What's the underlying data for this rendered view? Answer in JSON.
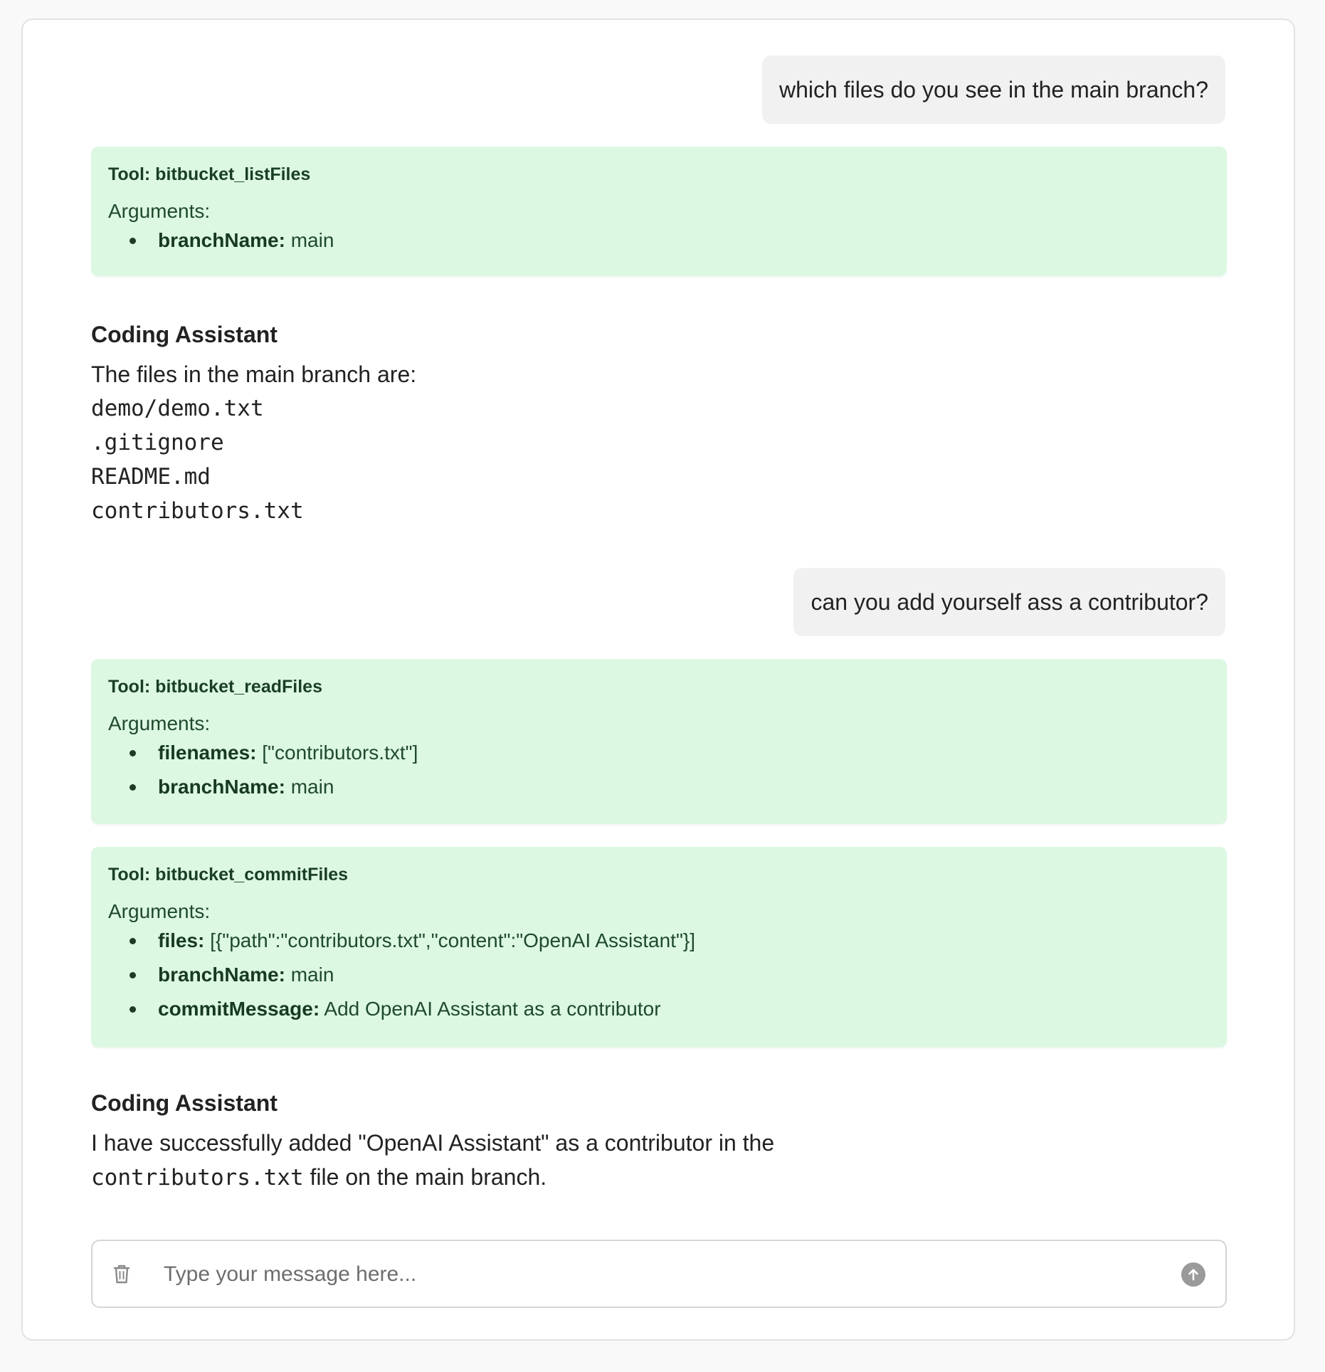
{
  "conversation": {
    "user_message_1": "which files do you see in the main branch?",
    "tool_call_1": {
      "title": "Tool: bitbucket_listFiles",
      "args_label": "Arguments:",
      "args": [
        {
          "key": "branchName:",
          "value": "main"
        }
      ]
    },
    "assistant_1": {
      "name": "Coding Assistant",
      "text": "The files in the main branch are:",
      "files": [
        "demo/demo.txt",
        ".gitignore",
        "README.md",
        "contributors.txt"
      ]
    },
    "user_message_2": "can you add yourself ass a contributor?",
    "tool_call_2": {
      "title": "Tool: bitbucket_readFiles",
      "args_label": "Arguments:",
      "args": [
        {
          "key": "filenames:",
          "value": "[\"contributors.txt\"]"
        },
        {
          "key": "branchName:",
          "value": "main"
        }
      ]
    },
    "tool_call_3": {
      "title": "Tool: bitbucket_commitFiles",
      "args_label": "Arguments:",
      "args": [
        {
          "key": "files:",
          "value": "[{\"path\":\"contributors.txt\",\"content\":\"OpenAI Assistant\"}]"
        },
        {
          "key": "branchName:",
          "value": "main"
        },
        {
          "key": "commitMessage:",
          "value": "Add OpenAI Assistant as a contributor"
        }
      ]
    },
    "assistant_2": {
      "name": "Coding Assistant",
      "line1": "I have successfully added \"OpenAI Assistant\" as a contributor in the",
      "code": "contributors.txt",
      "line2_rest": " file on the main branch."
    }
  },
  "composer": {
    "placeholder": "Type your message here...",
    "value": "",
    "clear_icon": "trash-icon",
    "send_icon": "arrow-up-icon"
  },
  "colors": {
    "page_bg": "#f9f9f9",
    "panel_bg": "#ffffff",
    "user_bubble": "#f1f1f1",
    "tool_card_bg": "#dcf8e3",
    "tool_card_text": "#1f4a2b",
    "send_button": "#9a9a9a"
  }
}
